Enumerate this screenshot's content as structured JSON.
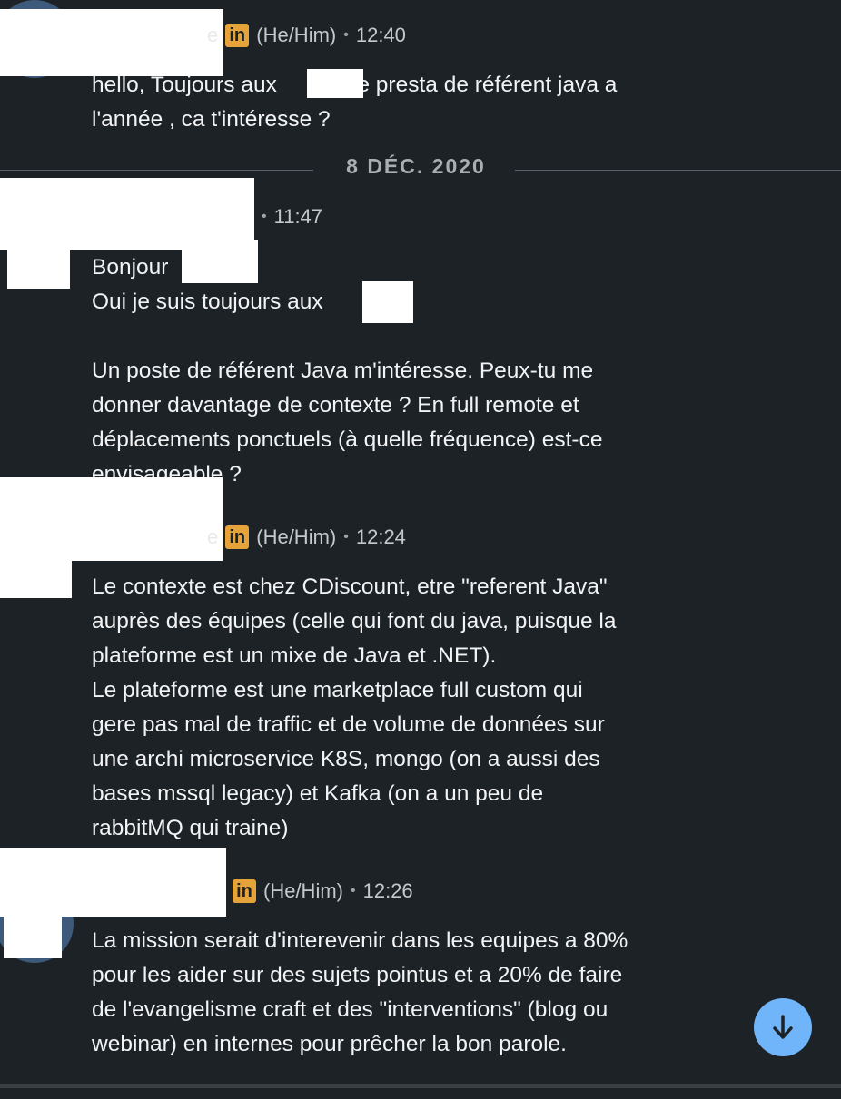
{
  "messages": [
    {
      "meta": {
        "pronouns": "(He/Him)",
        "time": "12:40",
        "linkedin": "in"
      },
      "text": "hello, Toujours aux      ? une presta de référent java a\nl'année , ca t'intéresse ?"
    },
    {
      "meta": {
        "time": "11:47"
      },
      "text": "Bonjour\nOui je suis toujours aux\n\nUn poste de référent Java m'intéresse. Peux-tu me\ndonner davantage de contexte ? En full remote et\ndéplacements ponctuels (à quelle fréquence) est-ce\nenvisageable ?"
    },
    {
      "meta": {
        "pronouns": "(He/Him)",
        "time": "12:24",
        "linkedin": "in"
      },
      "text": "Le contexte est chez CDiscount, etre \"referent Java\"\nauprès des équipes (celle qui font du java, puisque la\nplateforme est un mixe de Java et .NET).\nLe plateforme est une marketplace full custom qui\ngere pas mal de traffic et de volume de données sur\nune archi microservice K8S, mongo (on a aussi des\nbases mssql legacy) et Kafka (on a un peu de\nrabbitMQ qui traine)"
    },
    {
      "meta": {
        "pronouns": "(He/Him)",
        "time": "12:26",
        "linkedin": "in"
      },
      "text": "La mission serait d'interevenir dans les equipes a 80%\npour les aider sur des sujets pointus et a 20% de faire\nde l'evangelisme craft et des \"interventions\" (blog ou\nwebinar) en internes pour prêcher la bon parole."
    }
  ],
  "date_divider": "8 DÉC. 2020",
  "partial_name_char": "e",
  "separator": "•",
  "scroll_button": {
    "icon": "arrow-down-icon"
  },
  "colors": {
    "background": "#1d2226",
    "linkedin_badge": "#e6a33a",
    "scroll_button": "#70b5f9"
  }
}
